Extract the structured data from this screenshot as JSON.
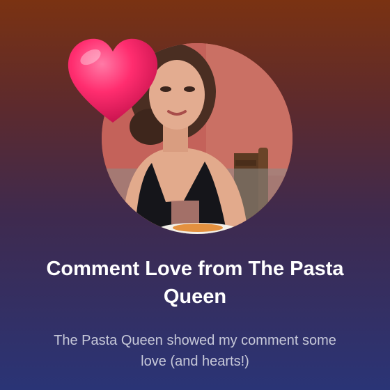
{
  "card": {
    "title": "Comment Love from The Pasta Queen",
    "subtitle": "The Pasta Queen showed my comment some love (and hearts!)"
  },
  "icons": {
    "reaction": "heart-icon"
  },
  "colors": {
    "title": "#ffffff",
    "subtitle": "#c7c9d9",
    "heart": "#ff2d6f"
  }
}
